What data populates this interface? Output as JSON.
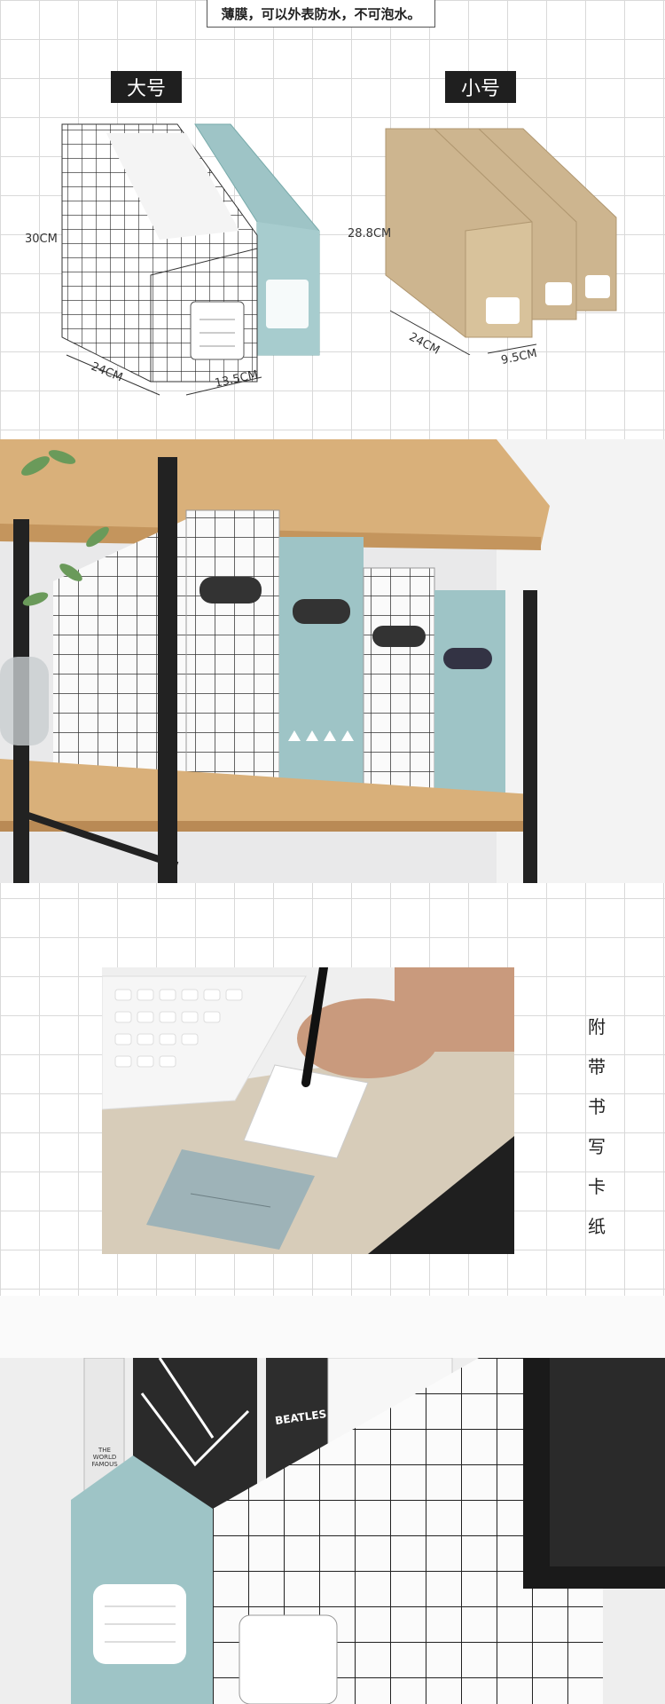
{
  "top_note": "薄膜，可以外表防水，不可泡水。",
  "sizes": {
    "large": {
      "label": "大号",
      "height": "30CM",
      "depth": "24CM",
      "width": "13.5CM"
    },
    "small": {
      "label": "小号",
      "height": "28.8CM",
      "depth": "24CM",
      "width": "9.5CM"
    }
  },
  "card_caption": [
    "附",
    "带",
    "书",
    "写",
    "卡",
    "纸"
  ],
  "book_spine_text": "THE WORLD FAMOUS",
  "book_title": "BEATLES",
  "colors": {
    "accent_blue": "#9ec4c6",
    "kraft": "#cdb58f",
    "wood": "#d9b07a",
    "metal": "#222222"
  }
}
